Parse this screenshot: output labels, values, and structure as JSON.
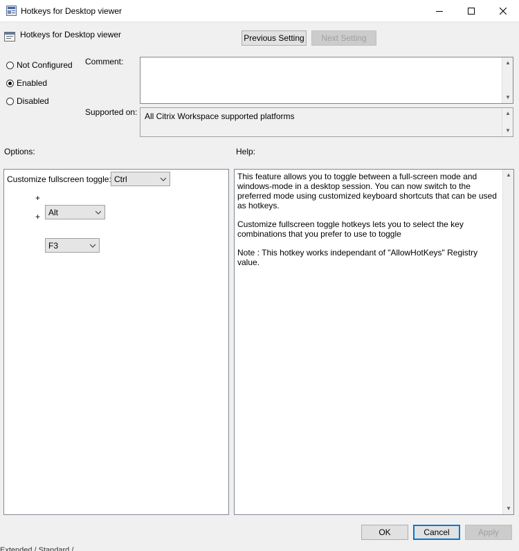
{
  "window": {
    "title": "Hotkeys for Desktop viewer",
    "minimize_label": "Minimize",
    "maximize_label": "Maximize",
    "close_label": "Close"
  },
  "header": {
    "policy_name": "Hotkeys for Desktop viewer",
    "previous_label": "Previous Setting",
    "next_label": "Next Setting"
  },
  "state": {
    "not_configured": "Not Configured",
    "enabled": "Enabled",
    "disabled": "Disabled",
    "selected": "Enabled"
  },
  "comment": {
    "label": "Comment:",
    "value": ""
  },
  "supported": {
    "label": "Supported on:",
    "value": "All Citrix Workspace supported platforms"
  },
  "options": {
    "label": "Options:",
    "toggle_label": "Customize fullscreen toggle:",
    "plus": "+",
    "key1": "Ctrl",
    "key2": "Alt",
    "key3": "F3"
  },
  "help": {
    "label": "Help:",
    "p1": "This feature allows you to toggle between a full-screen mode and windows-mode in a desktop session. You can now switch to the preferred mode using customized keyboard shortcuts that can be used as hotkeys.",
    "p2": "Customize fullscreen toggle hotkeys lets you to select the key combinations that you prefer to use to toggle",
    "p3": "Note : This hotkey works independant of \"AllowHotKeys\" Registry value."
  },
  "buttons": {
    "ok": "OK",
    "cancel": "Cancel",
    "apply": "Apply"
  },
  "background_tabs": "Extended / Standard /"
}
